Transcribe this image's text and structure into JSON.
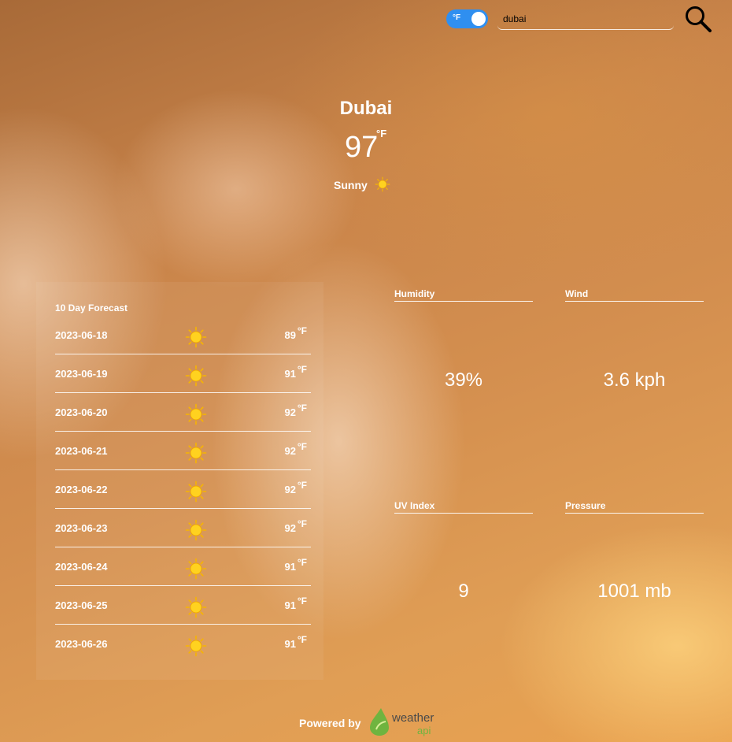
{
  "toggle": {
    "label": "°F"
  },
  "search": {
    "value": "dubai"
  },
  "current": {
    "city": "Dubai",
    "temp": "97",
    "unit": "°F",
    "condition": "Sunny",
    "condition_icon": "sun-icon"
  },
  "forecast": {
    "title": "10 Day Forecast",
    "unit": "°F",
    "days": [
      {
        "date": "2023-06-18",
        "temp": "89",
        "icon": "sun-icon"
      },
      {
        "date": "2023-06-19",
        "temp": "91",
        "icon": "sun-icon"
      },
      {
        "date": "2023-06-20",
        "temp": "92",
        "icon": "sun-icon"
      },
      {
        "date": "2023-06-21",
        "temp": "92",
        "icon": "sun-icon"
      },
      {
        "date": "2023-06-22",
        "temp": "92",
        "icon": "sun-icon"
      },
      {
        "date": "2023-06-23",
        "temp": "92",
        "icon": "sun-icon"
      },
      {
        "date": "2023-06-24",
        "temp": "91",
        "icon": "sun-icon"
      },
      {
        "date": "2023-06-25",
        "temp": "91",
        "icon": "sun-icon"
      },
      {
        "date": "2023-06-26",
        "temp": "91",
        "icon": "sun-icon"
      }
    ]
  },
  "stats": {
    "humidity": {
      "label": "Humidity",
      "value": "39%"
    },
    "wind": {
      "label": "Wind",
      "value": "3.6 kph"
    },
    "uv": {
      "label": "UV Index",
      "value": "9"
    },
    "pressure": {
      "label": "Pressure",
      "value": "1001 mb"
    }
  },
  "footer": {
    "label": "Powered by",
    "logo_text_1": "weather",
    "logo_text_2": "api"
  },
  "colors": {
    "toggle_accent": "#2f8ff0",
    "logo_green": "#6fb43f"
  }
}
